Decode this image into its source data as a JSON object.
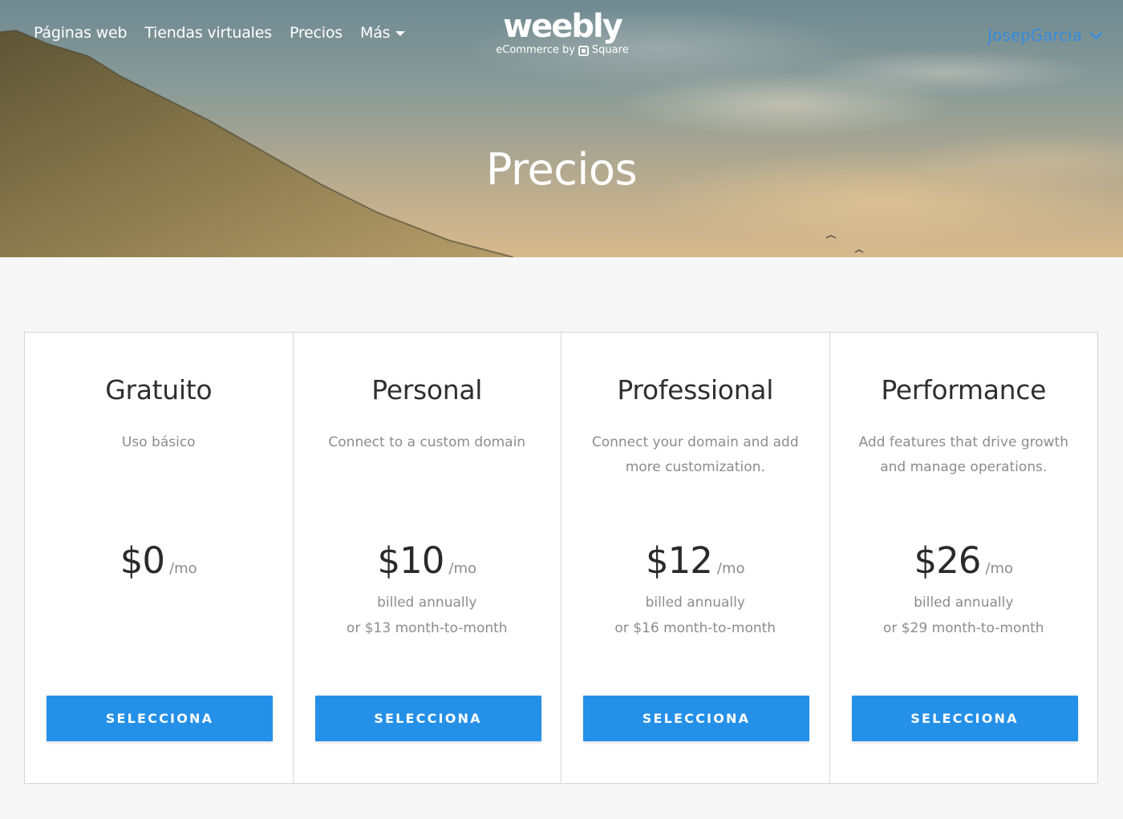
{
  "header": {
    "nav": [
      {
        "label": "Páginas web"
      },
      {
        "label": "Tiendas virtuales"
      },
      {
        "label": "Precios"
      },
      {
        "label": "Más"
      }
    ],
    "logo": {
      "word": "weebly",
      "sub_prefix": "eCommerce by",
      "sub_brand": "Square"
    },
    "user": {
      "name": "JosepGarcia"
    },
    "title": "Precios"
  },
  "plans": [
    {
      "name": "Gratuito",
      "description": "Uso básico",
      "price": "$0",
      "unit": "/mo",
      "billing_line1": "",
      "billing_line2": "",
      "button": "SELECCIONA"
    },
    {
      "name": "Personal",
      "description": "Connect to a custom domain",
      "price": "$10",
      "unit": "/mo",
      "billing_line1": "billed annually",
      "billing_line2": "or $13 month-to-month",
      "button": "SELECCIONA"
    },
    {
      "name": "Professional",
      "description": "Connect your domain and add more customization.",
      "price": "$12",
      "unit": "/mo",
      "billing_line1": "billed annually",
      "billing_line2": "or $16 month-to-month",
      "button": "SELECCIONA"
    },
    {
      "name": "Performance",
      "description": "Add features that drive growth and manage operations.",
      "price": "$26",
      "unit": "/mo",
      "billing_line1": "billed annually",
      "billing_line2": "or $29 month-to-month",
      "button": "SELECCIONA"
    }
  ],
  "colors": {
    "accent": "#2590e8",
    "user_link": "#2a8bea",
    "page_bg": "#f7f7f7"
  }
}
